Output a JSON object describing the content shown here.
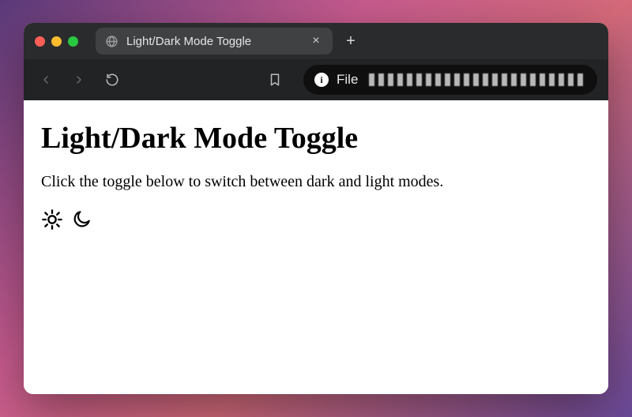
{
  "browser": {
    "tab_title": "Light/Dark Mode Toggle",
    "address_scheme_label": "File"
  },
  "page": {
    "heading": "Light/Dark Mode Toggle",
    "description": "Click the toggle below to switch between dark and light modes."
  }
}
